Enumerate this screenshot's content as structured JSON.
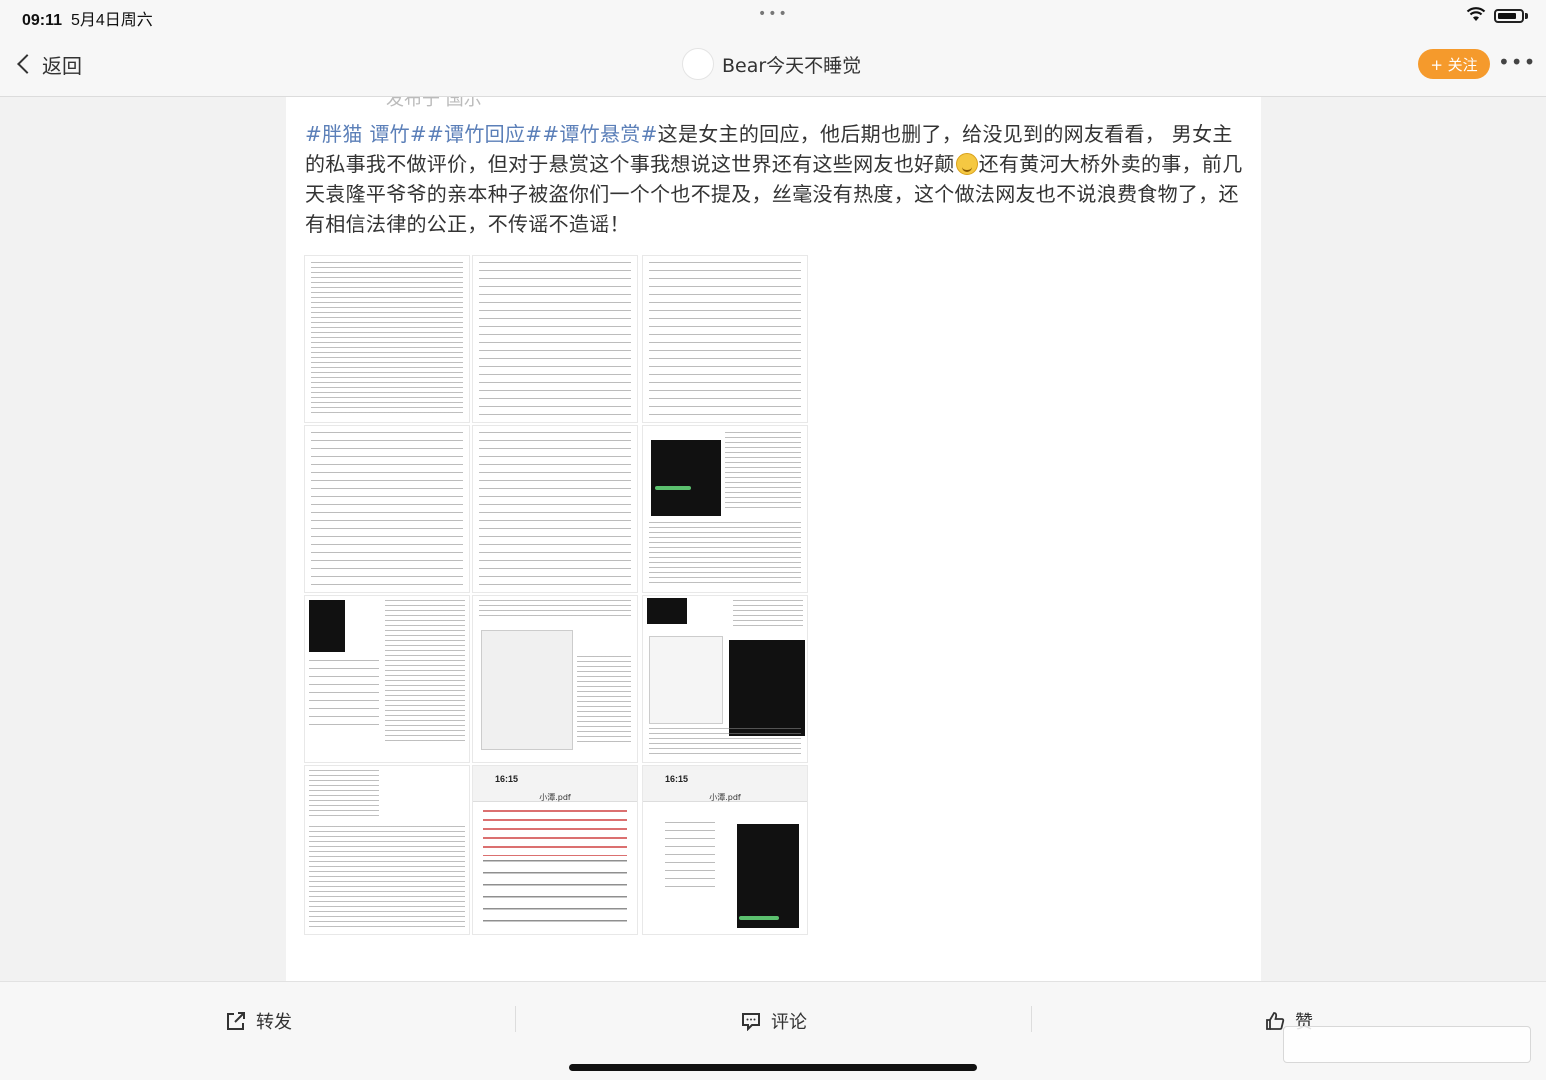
{
  "status_bar": {
    "time": "09:11",
    "date": "5月4日周六",
    "dots": "•••"
  },
  "nav": {
    "back_label": "返回",
    "username": "Bear今天不睡觉",
    "follow_label": "+ 关注",
    "more_label": "•••"
  },
  "post": {
    "cut_off_text": "发布于 国示",
    "hashtags": [
      "#胖猫 谭竹#",
      "#谭竹回应#",
      "#谭竹悬赏#"
    ],
    "text_before_emoji": "这是女主的回应，他后期也删了，给没见到的网友看看， 男女主的私事我不做评价，但对于悬赏这个事我想说这世界还有这些网友也好颠",
    "emoji_name": "laughing-crying-emoji",
    "text_after_emoji": "还有黄河大桥外卖的事，前几天袁隆平爷爷的亲本种子被盗你们一个个也不提及，丝毫没有热度，这个做法网友也不说浪费食物了，还有相信法律的公正，不传谣不造谣！"
  },
  "images": {
    "pdf_time": "16:15",
    "pdf_title": "小潭.pdf",
    "pdf_time_2": "16:15",
    "pdf_title_2": "小潭.pdf"
  },
  "toolbar": {
    "repost_label": "转发",
    "comment_label": "评论",
    "like_label": "赞"
  },
  "colors": {
    "accent_orange": "#f59a2c",
    "hashtag_blue": "#5b7fb8"
  }
}
